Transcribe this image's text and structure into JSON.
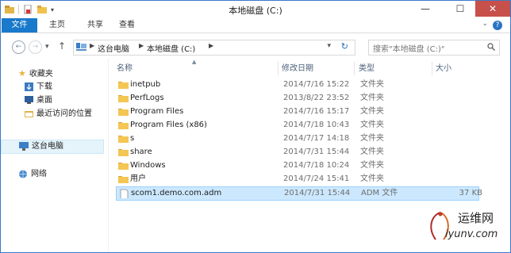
{
  "window": {
    "title": "本地磁盘 (C:)"
  },
  "window_controls": {
    "minimize": "—",
    "maximize": "☐",
    "close": "✕"
  },
  "ribbon": {
    "tabs": [
      "文件",
      "主页",
      "共享",
      "查看"
    ],
    "help": "?"
  },
  "nav": {
    "back": "←",
    "forward": "→",
    "up": "↑",
    "dropdown": "▾",
    "breadcrumb": [
      "这台电脑",
      "本地磁盘 (C:)"
    ],
    "search_placeholder": "搜索\"本地磁盘 (C:)\""
  },
  "sidebar": {
    "favorites_label": "收藏夹",
    "favorites": [
      "下载",
      "桌面",
      "最近访问的位置"
    ],
    "computer_label": "这台电脑",
    "network_label": "网络"
  },
  "columns": {
    "name": "名称",
    "date": "修改日期",
    "type": "类型",
    "size": "大小"
  },
  "files": [
    {
      "name": "inetpub",
      "date": "2014/7/16 15:22",
      "type": "文件夹",
      "size": "",
      "kind": "folder"
    },
    {
      "name": "PerfLogs",
      "date": "2013/8/22 23:52",
      "type": "文件夹",
      "size": "",
      "kind": "folder"
    },
    {
      "name": "Program Files",
      "date": "2014/7/16 15:17",
      "type": "文件夹",
      "size": "",
      "kind": "folder"
    },
    {
      "name": "Program Files (x86)",
      "date": "2014/7/18 10:43",
      "type": "文件夹",
      "size": "",
      "kind": "folder"
    },
    {
      "name": "s",
      "date": "2014/7/17 14:18",
      "type": "文件夹",
      "size": "",
      "kind": "folder"
    },
    {
      "name": "share",
      "date": "2014/7/31 15:44",
      "type": "文件夹",
      "size": "",
      "kind": "folder"
    },
    {
      "name": "Windows",
      "date": "2014/7/18 10:24",
      "type": "文件夹",
      "size": "",
      "kind": "folder"
    },
    {
      "name": "用户",
      "date": "2014/7/24 15:41",
      "type": "文件夹",
      "size": "",
      "kind": "folder"
    },
    {
      "name": "scom1.demo.com.adm",
      "date": "2014/7/31 15:44",
      "type": "ADM 文件",
      "size": "37 KB",
      "kind": "file"
    }
  ],
  "watermark": {
    "line1": "运维网",
    "line2": "iyunv.com"
  },
  "colors": {
    "accent": "#1979ca",
    "selection": "#cce8ff",
    "folder": "#f4c653"
  }
}
